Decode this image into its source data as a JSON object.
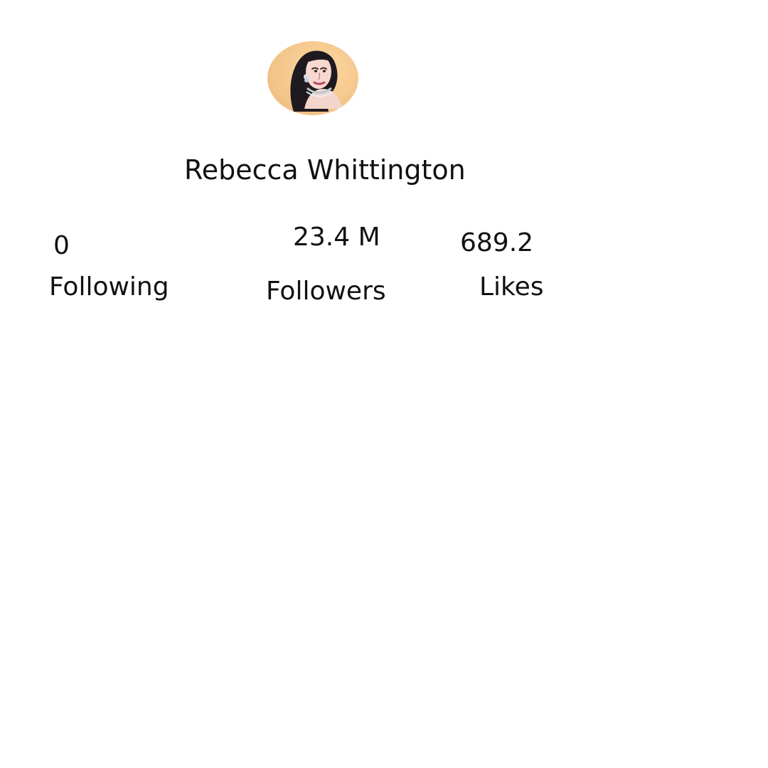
{
  "profile": {
    "name": "Rebecca Whittington",
    "avatar": "avatar-icon"
  },
  "stats": {
    "following": {
      "value": "0",
      "label": "Following"
    },
    "followers": {
      "value": "23.4 M",
      "label": "Followers"
    },
    "likes": {
      "value": "689.2",
      "label": "Likes"
    }
  },
  "colors": {
    "background": "#ffffff",
    "text": "#111111",
    "avatar_bg": "#f7c98d"
  }
}
